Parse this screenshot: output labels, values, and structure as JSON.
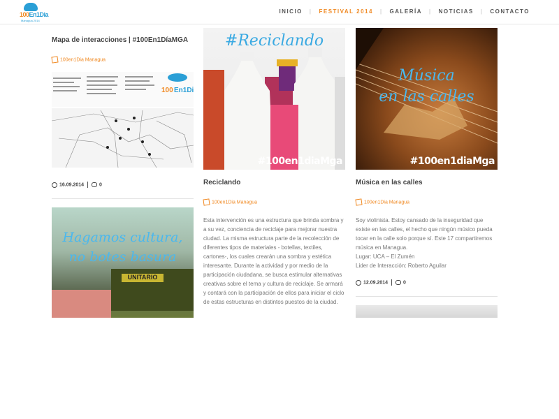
{
  "header": {
    "logo_main": "100",
    "logo_accent": "En1Dia",
    "logo_sub": "Managua 2014",
    "nav": [
      "INICIO",
      "FESTIVAL 2014",
      "GALERÍA",
      "NOTICIAS",
      "CONTACTO"
    ],
    "active_nav": "FESTIVAL 2014"
  },
  "posts": [
    {
      "title": "Mapa de interacciones | #100En1DíaMGA",
      "tag": "100en1Dia Managua",
      "date": "16.09.2014",
      "comments": "0"
    },
    {
      "title": "Reciclando",
      "tag": "100en1Dia Managua",
      "overlay": "#Reciclando",
      "hashtag": "#100en1diaMga",
      "excerpt": "Esta intervención es una estructura que brinda sombra y a su vez, conciencia de reciclaje para mejorar nuestra ciudad. La misma estructura parte de la recolección de diferentes tipos de materiales - botellas, textiles, cartones-, los cuales crearán una sombra y estética interesante. Durante la actividad y por medio de la participación ciudadana, se busca estimular alternativas creativas sobre el tema y cultura de reciclaje. Se armará y contará con la participación de ellos para iniciar el ciclo de estas estructuras en distintos puestos de la ciudad."
    },
    {
      "title": "Música en las calles",
      "tag": "100en1Dia Managua",
      "overlay_line1": "Música",
      "overlay_line2": "en las calles",
      "hashtag": "#100en1diaMga",
      "excerpt": "Soy violinista. Estoy cansado de la inseguridad que existe en las calles, el hecho que ningún músico pueda tocar en la calle solo porque sí. Este 17 compartiremos música en Managua.",
      "place": "Lugar: UCA – El Zumén",
      "leader": "Lider de Interacción: Roberto Aguilar",
      "date": "12.09.2014",
      "comments": "0"
    },
    {
      "overlay_line1": "Hagamos cultura,",
      "overlay_line2": "no botes basura",
      "bus_sign": "UNITARIO"
    }
  ],
  "colors": {
    "accent": "#f08a24",
    "brand_blue": "#2a9fd6",
    "overlay_blue": "#4ab8ee"
  }
}
